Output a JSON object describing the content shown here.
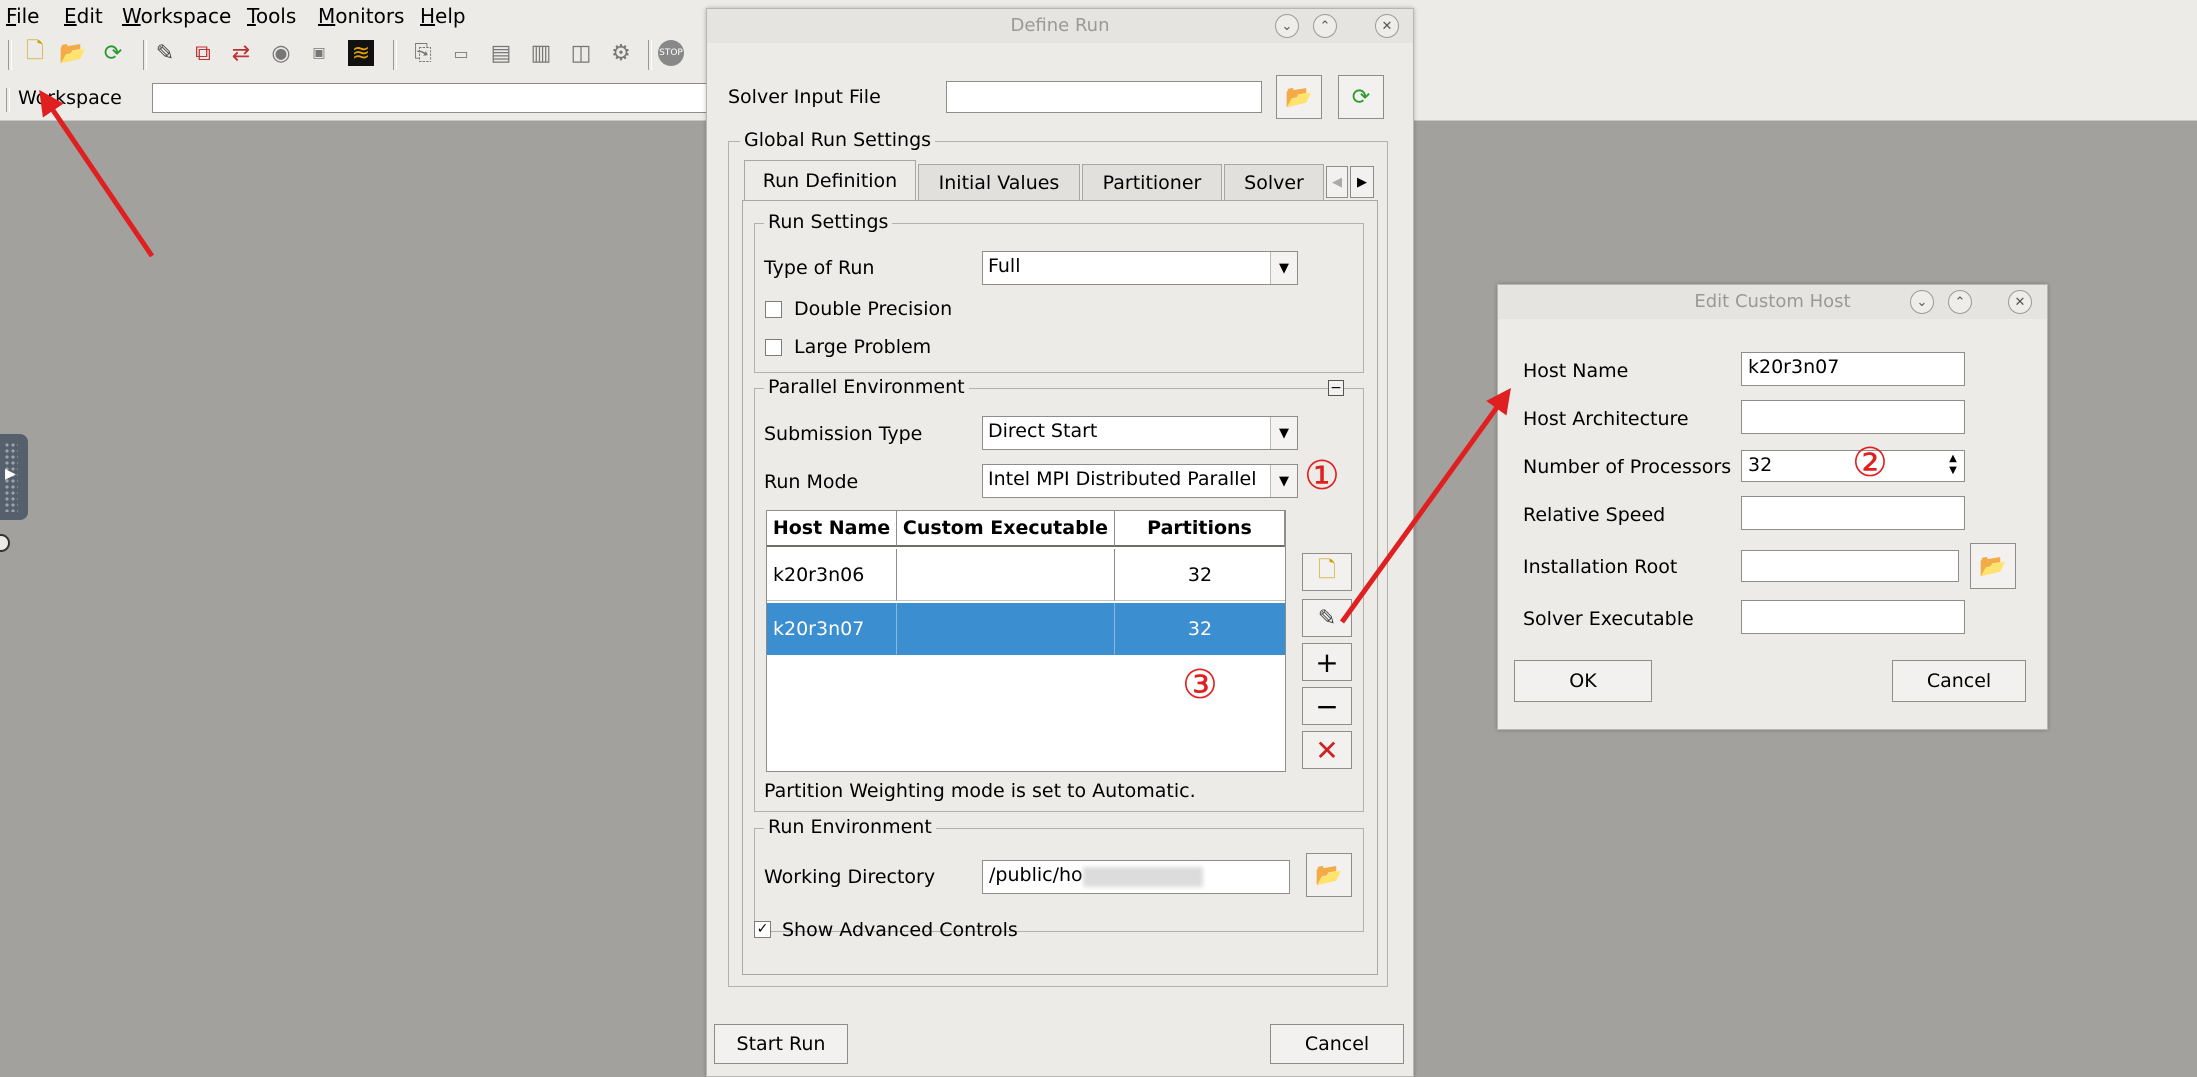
{
  "menubar": {
    "items": [
      "File",
      "Edit",
      "Workspace",
      "Tools",
      "Monitors",
      "Help"
    ]
  },
  "toolbar": {
    "icons": [
      "new-file-icon",
      "open-file-icon",
      "refresh-file-icon",
      "edit-icon",
      "copy-icon",
      "sync-icon",
      "disk-icon",
      "rsm-icon",
      "chart-icon",
      "page-icon",
      "small-page-icon",
      "grid-icon",
      "document-icon",
      "layout-icon",
      "settings-icon",
      "stop-icon"
    ]
  },
  "workspace_bar": {
    "label": "Workspace",
    "value": ""
  },
  "define_run": {
    "title": "Define Run",
    "solver_input_label": "Solver Input File",
    "solver_input_value": "",
    "global_settings_title": "Global Run Settings",
    "tabs": [
      "Run Definition",
      "Initial Values",
      "Partitioner",
      "Solver"
    ],
    "run_settings": {
      "title": "Run Settings",
      "type_label": "Type of Run",
      "type_value": "Full",
      "double_precision": "Double Precision",
      "large_problem": "Large Problem"
    },
    "parallel": {
      "title": "Parallel Environment",
      "submission_label": "Submission Type",
      "submission_value": "Direct Start",
      "run_mode_label": "Run Mode",
      "run_mode_value": "Intel MPI Distributed Parallel",
      "columns": [
        "Host Name",
        "Custom Executable",
        "Partitions"
      ],
      "rows": [
        {
          "host": "k20r3n06",
          "exe": "",
          "partitions": "32"
        },
        {
          "host": "k20r3n07",
          "exe": "",
          "partitions": "32"
        }
      ],
      "weighting_note": "Partition Weighting mode is set to Automatic."
    },
    "run_env": {
      "title": "Run Environment",
      "wd_label": "Working Directory",
      "wd_value": "/public/ho"
    },
    "show_advanced": "Show Advanced Controls",
    "start_run": "Start Run",
    "cancel": "Cancel"
  },
  "edit_host": {
    "title": "Edit Custom Host",
    "host_name_label": "Host Name",
    "host_name_value": "k20r3n07",
    "arch_label": "Host Architecture",
    "arch_value": "",
    "procs_label": "Number of Processors",
    "procs_value": "32",
    "speed_label": "Relative Speed",
    "speed_value": "",
    "install_label": "Installation Root",
    "install_value": "",
    "solver_exe_label": "Solver Executable",
    "solver_exe_value": "",
    "ok": "OK",
    "cancel": "Cancel"
  },
  "annotations": [
    "①",
    "②",
    "③"
  ],
  "colors": {
    "annotation": "#e02020",
    "selection": "#3b8ed0"
  }
}
